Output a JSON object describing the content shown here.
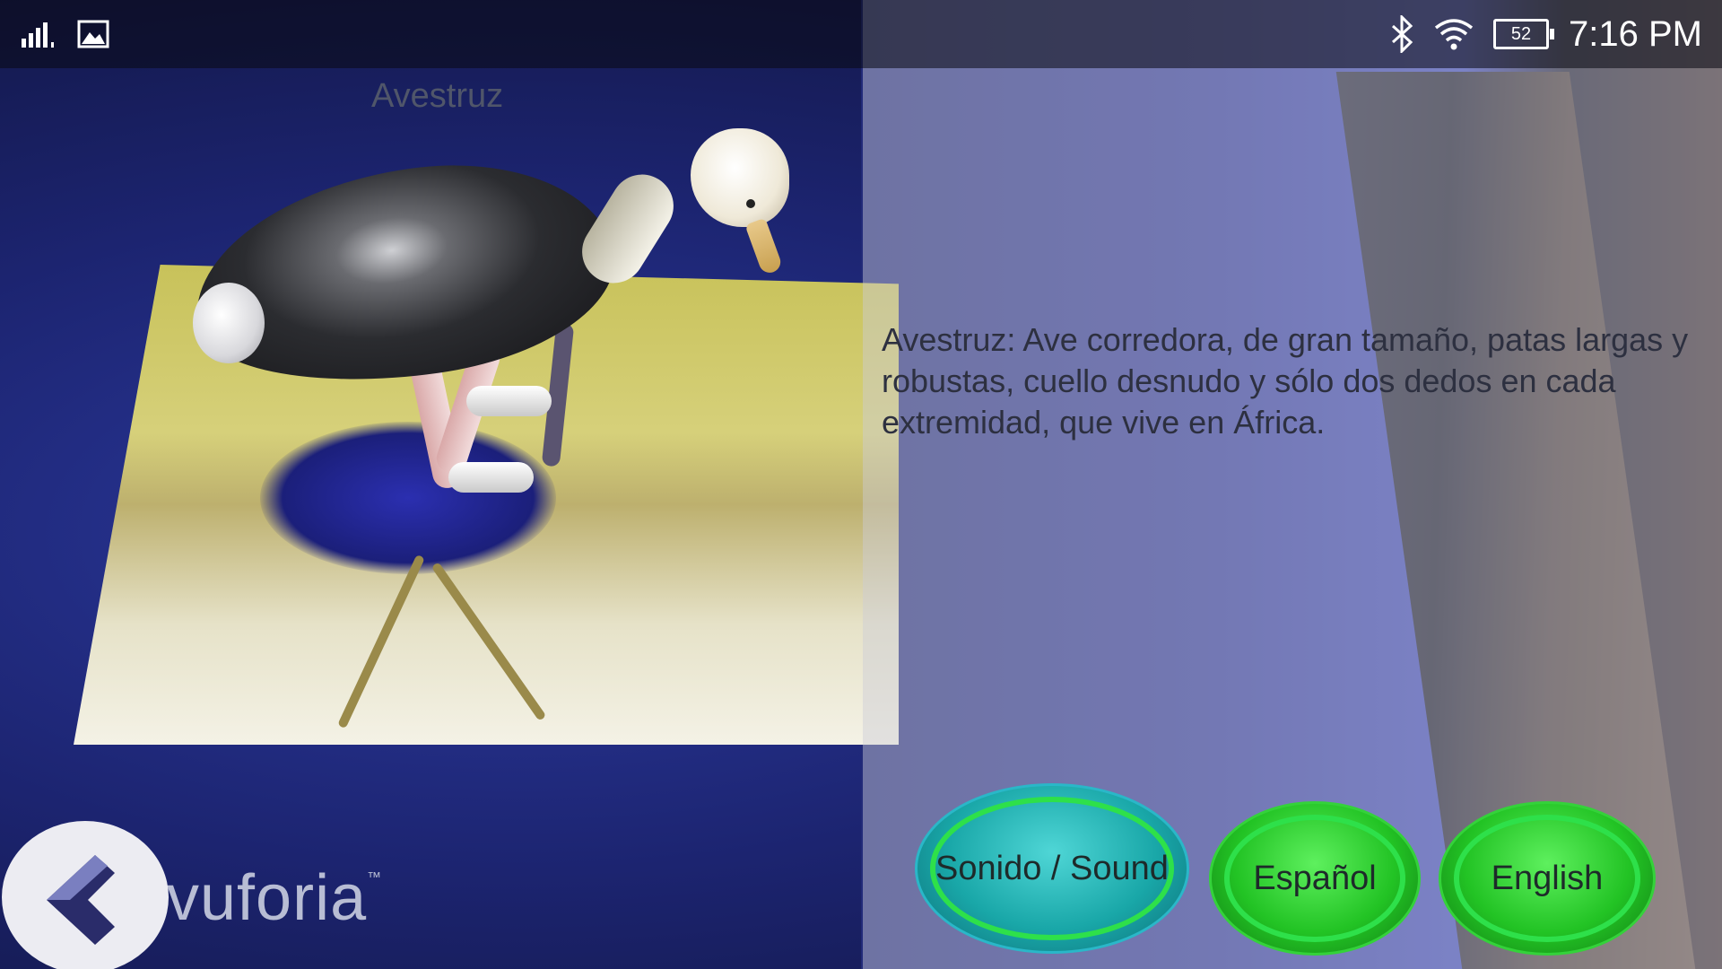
{
  "status_bar": {
    "time": "7:16 PM",
    "battery_level": "52",
    "icons": [
      "signal-icon",
      "image-notification-icon",
      "bluetooth-icon",
      "wifi-icon",
      "battery-icon"
    ]
  },
  "ar_view": {
    "model_title": "Avestruz",
    "watermark": "vuforia",
    "watermark_tm": "™"
  },
  "info": {
    "description": "Avestruz: Ave corredora, de gran tamaño, patas largas y robustas, cuello desnudo y sólo dos dedos en cada extremidad, que vive en África."
  },
  "buttons": {
    "back_icon": "chevron-left-icon",
    "sound_label": "Sonido / Sound",
    "spanish_label": "Español",
    "english_label": "English"
  },
  "colors": {
    "sound_button": "#19a7a8",
    "language_buttons": "#22c324",
    "button_ring": "#2ee04a"
  }
}
